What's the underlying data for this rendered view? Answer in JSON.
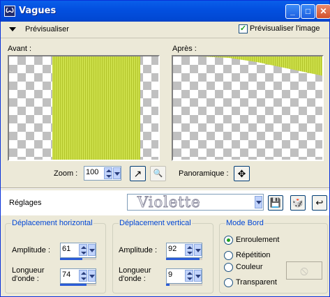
{
  "window": {
    "title": "Vagues",
    "app_icon": "paintshop-icon"
  },
  "titlebar": {
    "minimize": "_",
    "maximize": "□",
    "close": "✕"
  },
  "preview": {
    "toggle_label": "Prévisualiser",
    "checkbox_label": "Prévisualiser l'image",
    "checkbox_checked": true,
    "checkbox_mark": "✓"
  },
  "panels": {
    "avant_label": "Avant :",
    "apres_label": "Après :"
  },
  "stripe_color": "#cde04a",
  "zoom": {
    "label": "Zoom :",
    "value": "100",
    "fit_icon": "↗",
    "actual_icon": "🔍"
  },
  "pan": {
    "label": "Panoramique :",
    "icon": "✥"
  },
  "reglages": {
    "label": "Réglages",
    "preset": "Violette",
    "save_icon": "💾",
    "random_icon": "🎲",
    "reset_icon": "↩"
  },
  "horizontal": {
    "title": "Déplacement horizontal",
    "amplitude_label": "Amplitude :",
    "amplitude": "61",
    "amplitude_level": 0.61,
    "wavelength_label_1": "Longueur",
    "wavelength_label_2": "d'onde :",
    "wavelength": "74",
    "wavelength_level": 0.74
  },
  "vertical": {
    "title": "Déplacement vertical",
    "amplitude_label": "Amplitude :",
    "amplitude": "92",
    "amplitude_level": 0.92,
    "wavelength_label_1": "Longueur",
    "wavelength_label_2": "d'onde :",
    "wavelength": "9",
    "wavelength_level": 0.09
  },
  "mode_bord": {
    "title": "Mode Bord",
    "options": [
      "Enroulement",
      "Répétition",
      "Couleur",
      "Transparent"
    ],
    "selected": 0,
    "color_icon": "⃠"
  }
}
